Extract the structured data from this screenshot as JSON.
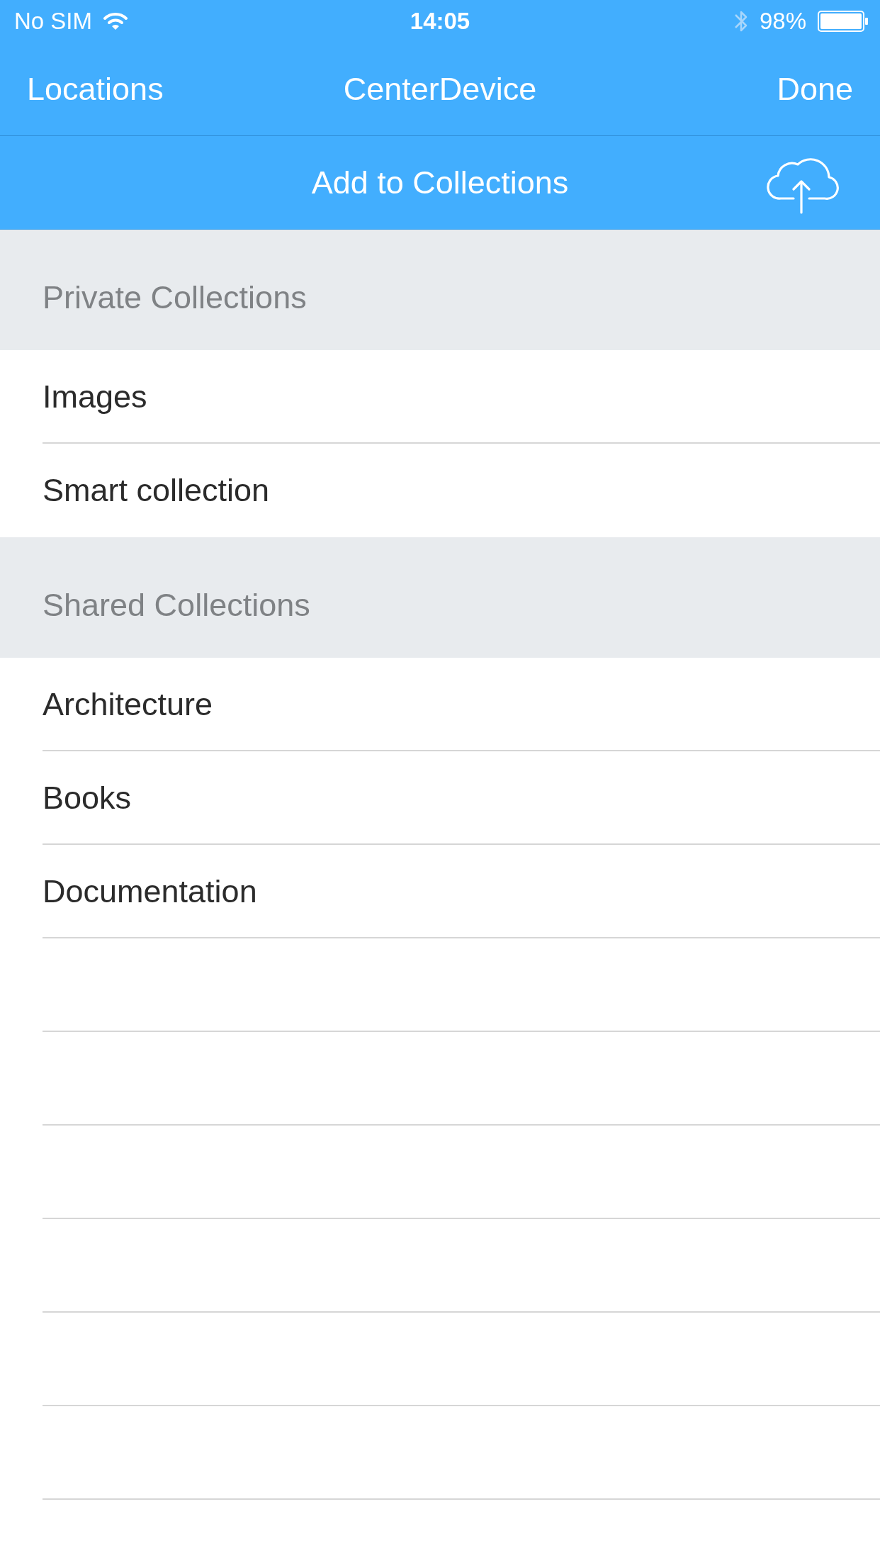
{
  "status_bar": {
    "carrier": "No SIM",
    "time": "14:05",
    "battery": "98%"
  },
  "nav_bar": {
    "left_button": "Locations",
    "title": "CenterDevice",
    "right_button": "Done"
  },
  "toolbar": {
    "title": "Add to Collections"
  },
  "sections": [
    {
      "title": "Private Collections",
      "items": [
        {
          "label": "Images"
        },
        {
          "label": "Smart collection"
        }
      ]
    },
    {
      "title": "Shared Collections",
      "items": [
        {
          "label": "Architecture"
        },
        {
          "label": "Books"
        },
        {
          "label": "Documentation"
        }
      ]
    }
  ]
}
